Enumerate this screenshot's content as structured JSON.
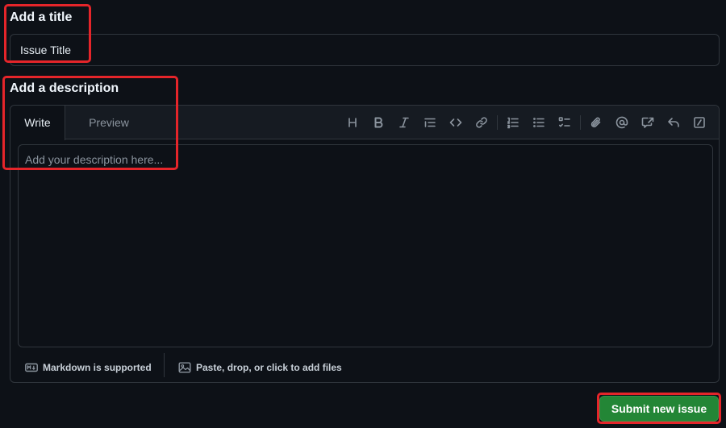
{
  "title_section": {
    "label": "Add a title",
    "value": "Issue Title"
  },
  "description_section": {
    "label": "Add a description",
    "tabs": [
      {
        "label": "Write",
        "active": true
      },
      {
        "label": "Preview",
        "active": false
      }
    ],
    "placeholder": "Add your description here...",
    "toolbar": [
      "heading-icon",
      "bold-icon",
      "italic-icon",
      "quote-icon",
      "code-icon",
      "link-icon",
      "numbered-list-icon",
      "unordered-list-icon",
      "task-list-icon",
      "attach-icon",
      "mention-icon",
      "cross-reference-icon",
      "saved-reply-icon",
      "slash-command-icon"
    ]
  },
  "footer": {
    "markdown_label": "Markdown is supported",
    "files_label": "Paste, drop, or click to add files"
  },
  "submit_label": "Submit new issue",
  "colors": {
    "background": "#0d1117",
    "border": "#30363d",
    "accent_green": "#238636",
    "highlight_red": "#e5252a"
  }
}
